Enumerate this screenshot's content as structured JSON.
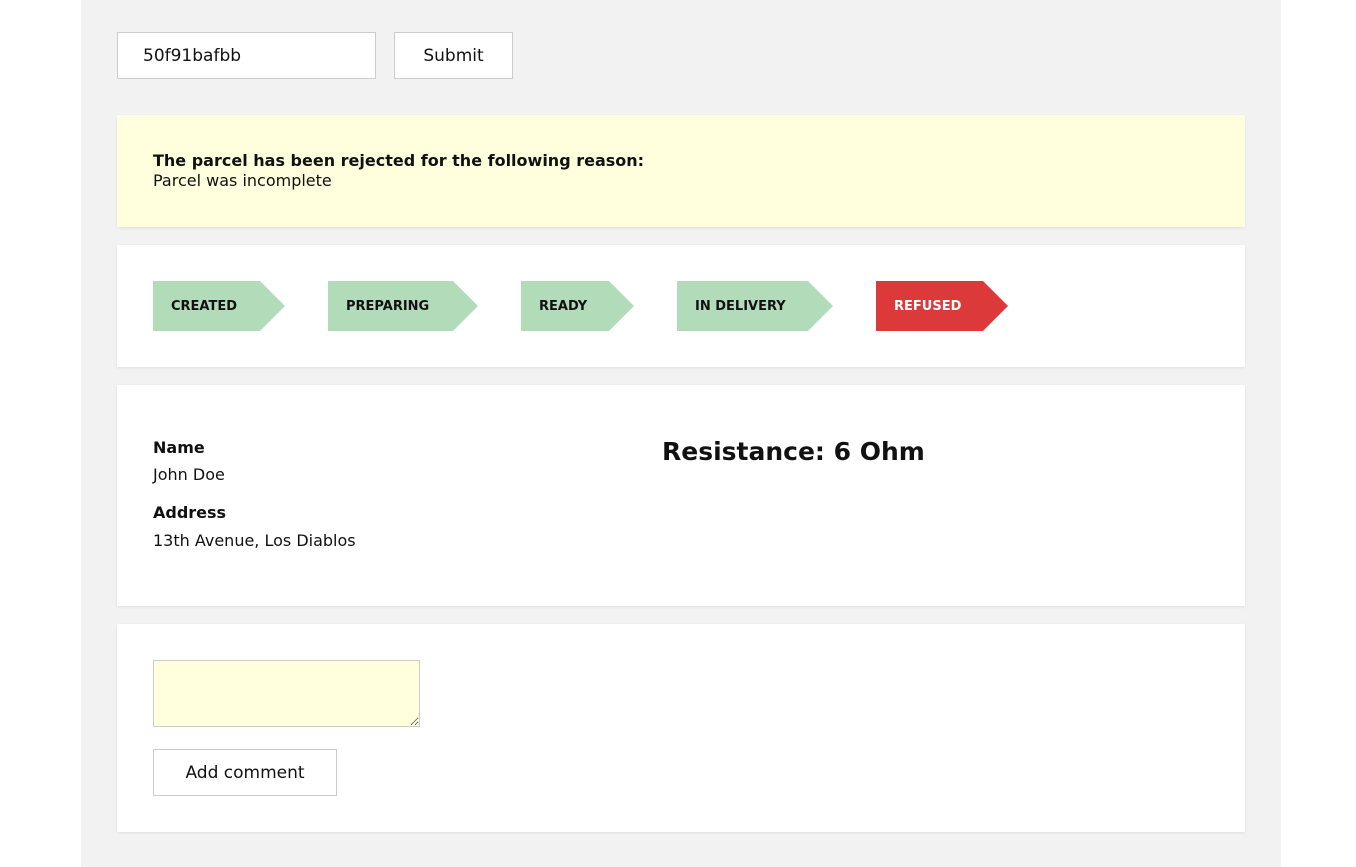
{
  "search": {
    "value": "50f91bafbb",
    "submit_label": "Submit"
  },
  "alert": {
    "title": "The parcel has been rejected for the following reason:",
    "reason": "Parcel was incomplete"
  },
  "steps": [
    {
      "label": "CREATED",
      "status": "done",
      "color": "#b2dbb9"
    },
    {
      "label": "PREPARING",
      "status": "done",
      "color": "#b2dbb9"
    },
    {
      "label": "READY",
      "status": "done",
      "color": "#b2dbb9"
    },
    {
      "label": "IN DELIVERY",
      "status": "done",
      "color": "#b2dbb9"
    },
    {
      "label": "REFUSED",
      "status": "current",
      "color": "#dc3a3a"
    }
  ],
  "details": {
    "name_label": "Name",
    "name": "John Doe",
    "address_label": "Address",
    "address": "13th Avenue, Los Diablos",
    "resistance": "Resistance: 6 Ohm"
  },
  "comment": {
    "value": "",
    "button_label": "Add comment"
  }
}
